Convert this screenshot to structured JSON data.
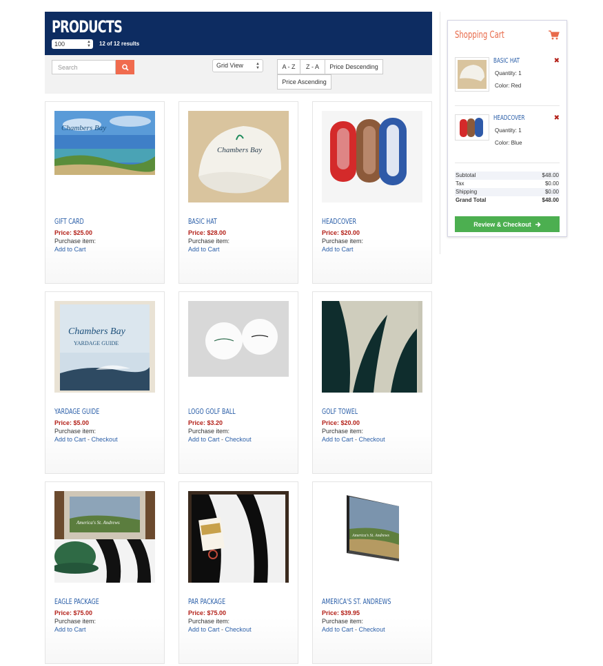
{
  "header": {
    "title": "PRODUCTS",
    "per_page": "100",
    "results": "12 of 12 results"
  },
  "toolbar": {
    "search_placeholder": "Search",
    "view": "Grid View",
    "sort": [
      "A - Z",
      "Z - A",
      "Price Descending",
      "Price Ascending"
    ]
  },
  "products": [
    {
      "name": "GIFT CARD",
      "price": "Price: $25.00",
      "purchase": "Purchase item:",
      "add": "Add to Cart",
      "checkout": ""
    },
    {
      "name": "BASIC HAT",
      "price": "Price: $28.00",
      "purchase": "Purchase item:",
      "add": "Add to Cart",
      "checkout": ""
    },
    {
      "name": "HEADCOVER",
      "price": "Price: $20.00",
      "purchase": "Purchase item:",
      "add": "Add to Cart",
      "checkout": ""
    },
    {
      "name": "YARDAGE GUIDE",
      "price": "Price: $5.00",
      "purchase": "Purchase item:",
      "add": "Add to Cart",
      "checkout": "Checkout"
    },
    {
      "name": "LOGO GOLF BALL",
      "price": "Price: $3.20",
      "purchase": "Purchase item:",
      "add": "Add to Cart",
      "checkout": "Checkout"
    },
    {
      "name": "GOLF TOWEL",
      "price": "Price: $20.00",
      "purchase": "Purchase item:",
      "add": "Add to Cart",
      "checkout": "Checkout"
    },
    {
      "name": "EAGLE PACKAGE",
      "price": "Price: $75.00",
      "purchase": "Purchase item:",
      "add": "Add to Cart",
      "checkout": ""
    },
    {
      "name": "PAR PACKAGE",
      "price": "Price: $75.00",
      "purchase": "Purchase item:",
      "add": "Add to Cart",
      "checkout": "Checkout"
    },
    {
      "name": "AMERICA'S ST. ANDREWS",
      "price": "Price: $39.95",
      "purchase": "Purchase item:",
      "add": "Add to Cart",
      "checkout": "Checkout"
    }
  ],
  "image_text": {
    "brand": "Chambers Bay",
    "yardage": "YARDAGE GUIDE",
    "book": "America's St. Andrews"
  },
  "cart": {
    "title": "Shopping Cart",
    "items": [
      {
        "name": "BASIC HAT",
        "qty": "Quantity: 1",
        "color": "Color: Red"
      },
      {
        "name": "HEADCOVER",
        "qty": "Quantity: 1",
        "color": "Color: Blue"
      }
    ],
    "totals": [
      {
        "label": "Subtotal",
        "value": "$48.00"
      },
      {
        "label": "Tax",
        "value": "$0.00"
      },
      {
        "label": "Shipping",
        "value": "$0.00"
      },
      {
        "label": "Grand Total",
        "value": "$48.00"
      }
    ],
    "checkout_label": "Review & Checkout"
  },
  "colors": {
    "header_bg": "#0d2c61",
    "accent_orange": "#f06b4e",
    "price_red": "#b32018",
    "link_blue": "#2a5ea8",
    "checkout_green": "#4caf50"
  },
  "icons": [
    "search-icon",
    "cart-icon",
    "remove-icon",
    "arrow-right-icon",
    "select-arrows-icon"
  ]
}
